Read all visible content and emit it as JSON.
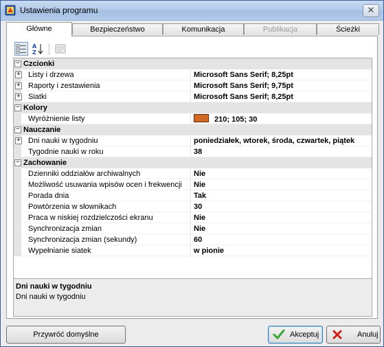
{
  "window": {
    "title": "Ustawienia programu",
    "close_glyph": "✕"
  },
  "tabs": [
    {
      "label": "Główne",
      "active": true,
      "enabled": true
    },
    {
      "label": "Bezpieczeństwo",
      "active": false,
      "enabled": true
    },
    {
      "label": "Komunikacja",
      "active": false,
      "enabled": true
    },
    {
      "label": "Publikacja",
      "active": false,
      "enabled": false
    },
    {
      "label": "Ścieżki",
      "active": false,
      "enabled": true
    }
  ],
  "toolbar": {
    "buttons": [
      {
        "icon": "categorized-view-icon",
        "pressed": true
      },
      {
        "icon": "sort-alphabetical-icon",
        "pressed": false
      },
      {
        "icon": "property-pages-icon",
        "pressed": false,
        "enabled": false
      }
    ]
  },
  "grid": {
    "categories": [
      {
        "label": "Czcionki",
        "expanded": true,
        "items": [
          {
            "label": "Listy i drzewa",
            "value": "Microsoft Sans Serif; 8,25pt",
            "expandable": true
          },
          {
            "label": "Raporty i zestawienia",
            "value": "Microsoft Sans Serif; 9,75pt",
            "expandable": true
          },
          {
            "label": "Siatki",
            "value": "Microsoft Sans Serif; 8,25pt",
            "expandable": true
          }
        ]
      },
      {
        "label": "Kolory",
        "expanded": true,
        "items": [
          {
            "label": "Wyróżnienie listy",
            "value": "210; 105; 30",
            "expandable": false,
            "color": "#d26922"
          }
        ]
      },
      {
        "label": "Nauczanie",
        "expanded": true,
        "items": [
          {
            "label": "Dni nauki w tygodniu",
            "value": "poniedziałek, wtorek, środa, czwartek, piątek",
            "expandable": true
          },
          {
            "label": "Tygodnie nauki w roku",
            "value": "38",
            "expandable": false
          }
        ]
      },
      {
        "label": "Zachowanie",
        "expanded": true,
        "items": [
          {
            "label": "Dzienniki oddziałów archiwalnych",
            "value": "Nie",
            "expandable": false
          },
          {
            "label": "Możliwość usuwania wpisów ocen i frekwencji",
            "value": "Nie",
            "expandable": false
          },
          {
            "label": "Porada dnia",
            "value": "Tak",
            "expandable": false
          },
          {
            "label": "Powtórzenia w słownikach",
            "value": "30",
            "expandable": false
          },
          {
            "label": "Praca w niskiej rozdzielczości ekranu",
            "value": "Nie",
            "expandable": false
          },
          {
            "label": "Synchronizacja zmian",
            "value": "Nie",
            "expandable": false
          },
          {
            "label": "Synchronizacja zmian (sekundy)",
            "value": "60",
            "expandable": false
          },
          {
            "label": "Wypełnianie siatek",
            "value": "w pionie",
            "expandable": false
          }
        ]
      }
    ]
  },
  "description": {
    "title": "Dni nauki w tygodniu",
    "text": "Dni nauki w tygodniu"
  },
  "buttons": {
    "reset_label": "Przywróć domyślne",
    "accept_label": "Akceptuj",
    "cancel_label": "Anuluj"
  },
  "colors": {
    "titlebar": "#b4cbe9",
    "accept_icon": "#3aa635",
    "cancel_icon": "#d0201c",
    "highlight_swatch": "#d26922"
  }
}
